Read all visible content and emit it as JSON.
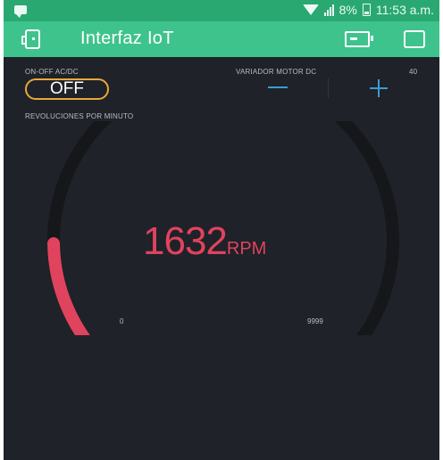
{
  "status_bar": {
    "battery_percent": "8%",
    "time": "11:53 a.m."
  },
  "app_bar": {
    "title": "Interfaz IoT",
    "left_icon": "device-settings-icon",
    "device_icon": "device-icon",
    "stop_icon": "stop-icon"
  },
  "switch_widget": {
    "label": "ON-OFF AC/DC",
    "state_label": "OFF"
  },
  "stepper_widget": {
    "label": "VARIADOR MOTOR DC",
    "value": "40",
    "decrement_icon": "minus-icon",
    "increment_icon": "plus-icon"
  },
  "gauge_widget": {
    "label": "REVOLUCIONES POR MINUTO",
    "value": "1632",
    "unit": "RPM",
    "min": "0",
    "max": "9999",
    "fill_fraction": 0.1632
  },
  "colors": {
    "status_bar": "#2aa872",
    "app_bar": "#3ec38c",
    "background": "#1f2228",
    "button_border": "#e7a93b",
    "stepper_accent": "#3b9bd3",
    "gauge_fill": "#e0435e",
    "gauge_track": "#15171b"
  }
}
